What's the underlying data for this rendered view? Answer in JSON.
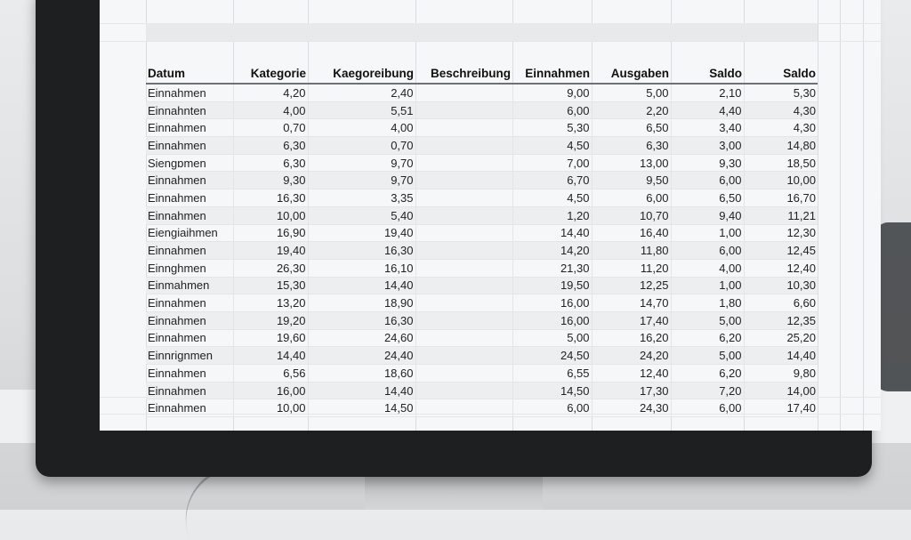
{
  "sheet": {
    "columns": [
      "Datum",
      "Kategorie",
      "Kaegoreibung",
      "Beschreibung",
      "Einnahmen",
      "Ausgaben",
      "Saldo",
      "Saldo"
    ],
    "rows": [
      [
        "Einnahmen",
        "4,20",
        "2,40",
        "",
        "9,00",
        "5,00",
        "2,10",
        "5,30"
      ],
      [
        "Einnahnten",
        "4,00",
        "5,51",
        "",
        "6,00",
        "2,20",
        "4,40",
        "4,30"
      ],
      [
        "Einnahmen",
        "0,70",
        "4,00",
        "",
        "5,30",
        "6,50",
        "3,40",
        "4,30"
      ],
      [
        "Einnahmen",
        "6,30",
        "0,70",
        "",
        "4,50",
        "6,30",
        "3,00",
        "14,80"
      ],
      [
        "Siengɒmen",
        "6,30",
        "9,70",
        "",
        "7,00",
        "13,00",
        "9,30",
        "18,50"
      ],
      [
        "Einnahmen",
        "9,30",
        "9,70",
        "",
        "6,70",
        "9,50",
        "6,00",
        "10,00"
      ],
      [
        "Einnahmen",
        "16,30",
        "3,35",
        "",
        "4,50",
        "6,00",
        "6,50",
        "16,70"
      ],
      [
        "Einnahmen",
        "10,00",
        "5,40",
        "",
        "1,20",
        "10,70",
        "9,40",
        "11,21"
      ],
      [
        "Eiengiaihmen",
        "16,90",
        "19,40",
        "",
        "14,40",
        "16,40",
        "1,00",
        "12,30"
      ],
      [
        "Einnahmen",
        "19,40",
        "16,30",
        "",
        "14,20",
        "11,80",
        "6,00",
        "12,45"
      ],
      [
        "Einnghmen",
        "26,30",
        "16,10",
        "",
        "21,30",
        "11,20",
        "4,00",
        "12,40"
      ],
      [
        "Einmahmen",
        "15,30",
        "14,40",
        "",
        "19,50",
        "12,25",
        "1,00",
        "10,30"
      ],
      [
        "Einnahmen",
        "13,20",
        "18,90",
        "",
        "16,00",
        "14,70",
        "1,80",
        "6,60"
      ],
      [
        "Einnahmen",
        "19,20",
        "16,30",
        "",
        "16,00",
        "17,40",
        "5,00",
        "12,35"
      ],
      [
        "Einnahmen",
        "19,60",
        "24,60",
        "",
        "5,00",
        "16,20",
        "6,20",
        "25,20"
      ],
      [
        "Einnrignmen",
        "14,40",
        "24,40",
        "",
        "24,50",
        "24,20",
        "5,00",
        "14,40"
      ],
      [
        "Einnahmen",
        "6,56",
        "18,60",
        "",
        "6,55",
        "12,40",
        "6,20",
        "9,80"
      ],
      [
        "Einnahmen",
        "16,00",
        "14,40",
        "",
        "14,50",
        "17,30",
        "7,20",
        "14,00"
      ],
      [
        "Einnahmen",
        "10,00",
        "14,50",
        "",
        "6,00",
        "24,30",
        "6,00",
        "17,40"
      ]
    ]
  }
}
